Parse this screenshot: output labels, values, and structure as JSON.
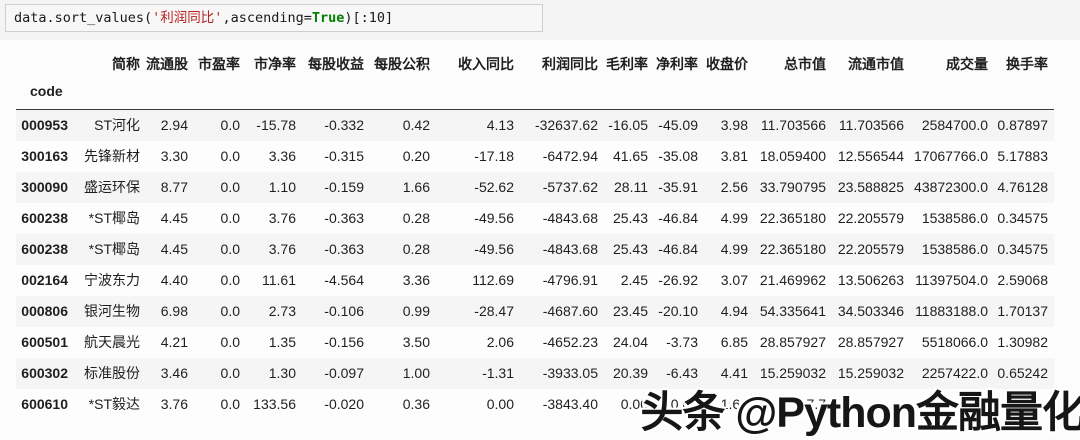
{
  "code_cell": {
    "prefix": "data.sort_values(",
    "string_arg": "'利润同比'",
    "middle": ",ascending=",
    "keyword": "True",
    "suffix": ")[:10]"
  },
  "table": {
    "index_name": "code",
    "columns": [
      "简称",
      "流通股",
      "市盈率",
      "市净率",
      "每股收益",
      "每股公积",
      "收入同比",
      "利润同比",
      "毛利率",
      "净利率",
      "收盘价",
      "总市值",
      "流通市值",
      "成交量",
      "换手率"
    ],
    "rows": [
      {
        "code": "000953",
        "cells": [
          "ST河化",
          "2.94",
          "0.0",
          "-15.78",
          "-0.332",
          "0.42",
          "4.13",
          "-32637.62",
          "-16.05",
          "-45.09",
          "3.98",
          "11.703566",
          "11.703566",
          "2584700.0",
          "0.87897"
        ]
      },
      {
        "code": "300163",
        "cells": [
          "先锋新材",
          "3.30",
          "0.0",
          "3.36",
          "-0.315",
          "0.20",
          "-17.18",
          "-6472.94",
          "41.65",
          "-35.08",
          "3.81",
          "18.059400",
          "12.556544",
          "17067766.0",
          "5.17883"
        ]
      },
      {
        "code": "300090",
        "cells": [
          "盛运环保",
          "8.77",
          "0.0",
          "1.10",
          "-0.159",
          "1.66",
          "-52.62",
          "-5737.62",
          "28.11",
          "-35.91",
          "2.56",
          "33.790795",
          "23.588825",
          "43872300.0",
          "4.76128"
        ]
      },
      {
        "code": "600238",
        "cells": [
          "*ST椰岛",
          "4.45",
          "0.0",
          "3.76",
          "-0.363",
          "0.28",
          "-49.56",
          "-4843.68",
          "25.43",
          "-46.84",
          "4.99",
          "22.365180",
          "22.205579",
          "1538586.0",
          "0.34575"
        ]
      },
      {
        "code": "600238",
        "cells": [
          "*ST椰岛",
          "4.45",
          "0.0",
          "3.76",
          "-0.363",
          "0.28",
          "-49.56",
          "-4843.68",
          "25.43",
          "-46.84",
          "4.99",
          "22.365180",
          "22.205579",
          "1538586.0",
          "0.34575"
        ]
      },
      {
        "code": "002164",
        "cells": [
          "宁波东力",
          "4.40",
          "0.0",
          "11.61",
          "-4.564",
          "3.36",
          "112.69",
          "-4796.91",
          "2.45",
          "-26.92",
          "3.07",
          "21.469962",
          "13.506263",
          "11397504.0",
          "2.59068"
        ]
      },
      {
        "code": "000806",
        "cells": [
          "银河生物",
          "6.98",
          "0.0",
          "2.73",
          "-0.106",
          "0.99",
          "-28.47",
          "-4687.60",
          "23.45",
          "-20.10",
          "4.94",
          "54.335641",
          "34.503346",
          "11883188.0",
          "1.70137"
        ]
      },
      {
        "code": "600501",
        "cells": [
          "航天晨光",
          "4.21",
          "0.0",
          "1.35",
          "-0.156",
          "3.50",
          "2.06",
          "-4652.23",
          "24.04",
          "-3.73",
          "6.85",
          "28.857927",
          "28.857927",
          "5518066.0",
          "1.30982"
        ]
      },
      {
        "code": "600302",
        "cells": [
          "标准股份",
          "3.46",
          "0.0",
          "1.30",
          "-0.097",
          "1.00",
          "-1.31",
          "-3933.05",
          "20.39",
          "-6.43",
          "4.41",
          "15.259032",
          "15.259032",
          "2257422.0",
          "0.65242"
        ]
      },
      {
        "code": "600610",
        "cells": [
          "*ST毅达",
          "3.76",
          "0.0",
          "133.56",
          "-0.020",
          "0.36",
          "0.00",
          "-3843.40",
          "0.00",
          "0.00",
          "1.66",
          "17.7",
          "",
          "",
          ""
        ]
      }
    ]
  },
  "watermark": {
    "text": "头条 @Python金融量化"
  }
}
